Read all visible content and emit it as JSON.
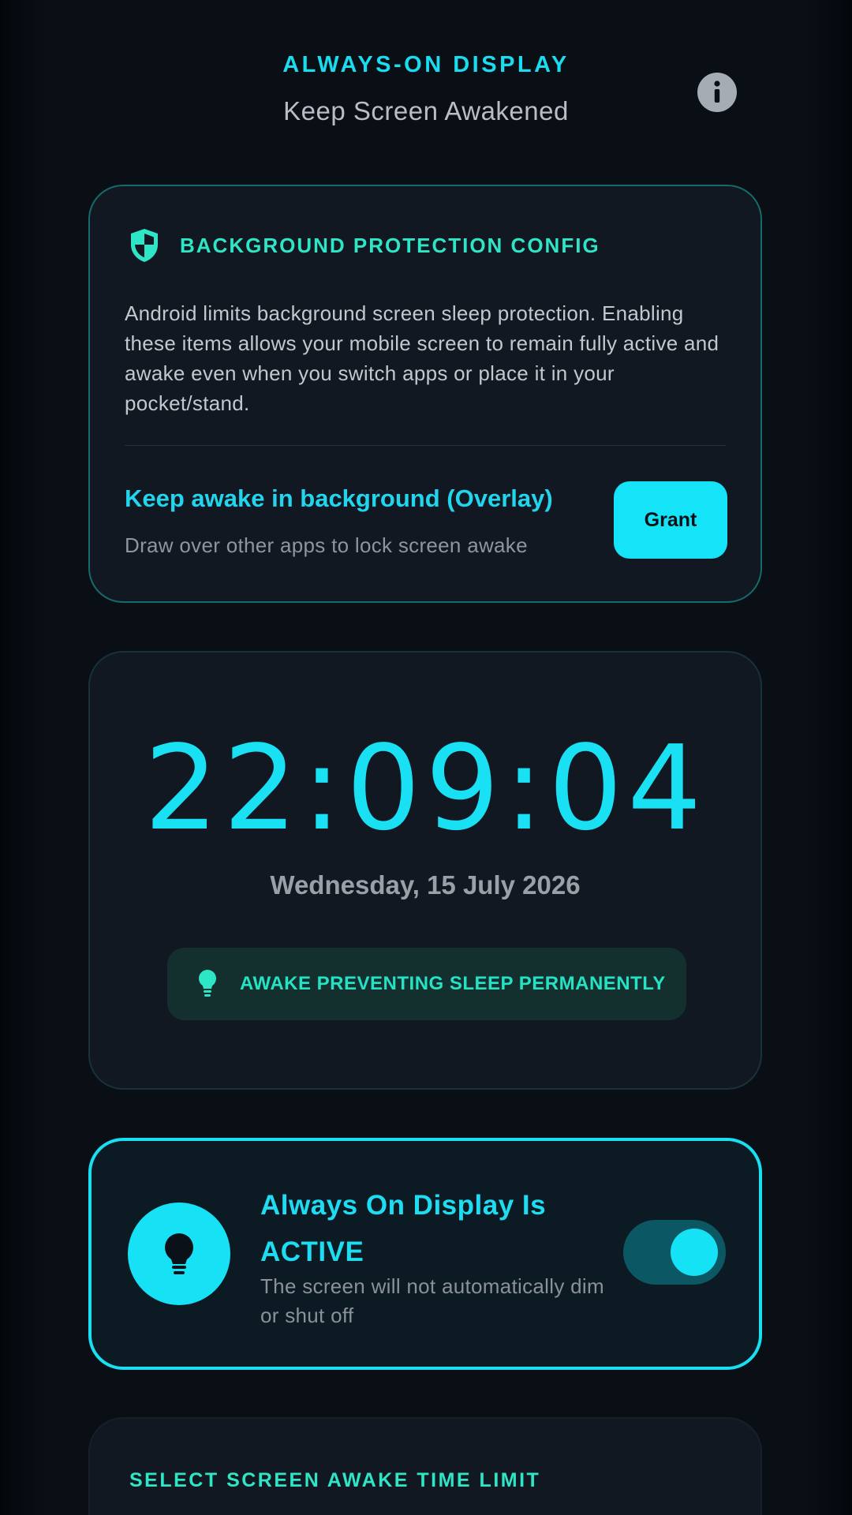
{
  "header": {
    "title": "ALWAYS-ON DISPLAY",
    "subtitle": "Keep Screen Awakened",
    "info_icon": "info-icon"
  },
  "protection": {
    "icon": "shield-icon",
    "title": "BACKGROUND PROTECTION CONFIG",
    "description": "Android limits background screen sleep protection. Enabling these items allows your mobile screen to remain fully active and awake even when you switch apps or place it in your pocket/stand.",
    "overlay_title": "Keep awake in background (Overlay)",
    "overlay_description": "Draw over other apps to lock screen awake",
    "grant_label": "Grant"
  },
  "clock": {
    "time": "22:09:04",
    "date": "Wednesday, 15 July 2026",
    "status_icon": "lightbulb-icon",
    "status_text": "AWAKE PREVENTING SLEEP PERMANENTLY"
  },
  "active_card": {
    "icon": "lightbulb-icon",
    "title": "Always On Display Is ACTIVE",
    "description": "The screen will not automatically dim or shut off",
    "toggle_on": true
  },
  "time_limit": {
    "title": "SELECT SCREEN AWAKE TIME LIMIT"
  },
  "colors": {
    "accent_cyan": "#19dcf0",
    "accent_teal": "#2ee6c6",
    "background": "#0a0e15",
    "card": "#111822"
  }
}
